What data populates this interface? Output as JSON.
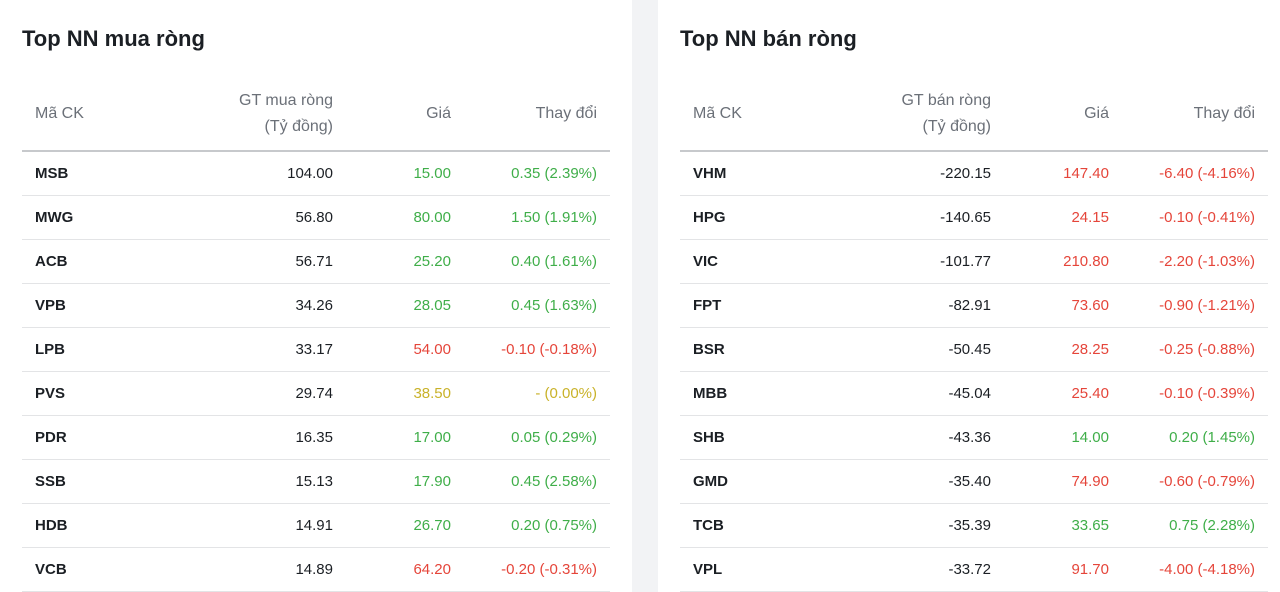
{
  "colors": {
    "up": "#3fae49",
    "down": "#e5453a",
    "reference": "#c9b229",
    "text": "#1b1f24",
    "header_text": "#6b7078"
  },
  "buy_panel": {
    "title": "Top NN mua ròng",
    "headers": {
      "symbol": "Mã CK",
      "value_line1": "GT mua ròng",
      "value_line2": "(Tỷ đồng)",
      "price": "Giá",
      "change": "Thay đổi"
    },
    "rows": [
      {
        "symbol": "MSB",
        "value": "104.00",
        "price": "15.00",
        "change": "0.35 (2.39%)",
        "trend": "up"
      },
      {
        "symbol": "MWG",
        "value": "56.80",
        "price": "80.00",
        "change": "1.50 (1.91%)",
        "trend": "up"
      },
      {
        "symbol": "ACB",
        "value": "56.71",
        "price": "25.20",
        "change": "0.40 (1.61%)",
        "trend": "up"
      },
      {
        "symbol": "VPB",
        "value": "34.26",
        "price": "28.05",
        "change": "0.45 (1.63%)",
        "trend": "up"
      },
      {
        "symbol": "LPB",
        "value": "33.17",
        "price": "54.00",
        "change": "-0.10 (-0.18%)",
        "trend": "down"
      },
      {
        "symbol": "PVS",
        "value": "29.74",
        "price": "38.50",
        "change": "- (0.00%)",
        "trend": "ref"
      },
      {
        "symbol": "PDR",
        "value": "16.35",
        "price": "17.00",
        "change": "0.05 (0.29%)",
        "trend": "up"
      },
      {
        "symbol": "SSB",
        "value": "15.13",
        "price": "17.90",
        "change": "0.45 (2.58%)",
        "trend": "up"
      },
      {
        "symbol": "HDB",
        "value": "14.91",
        "price": "26.70",
        "change": "0.20 (0.75%)",
        "trend": "up"
      },
      {
        "symbol": "VCB",
        "value": "14.89",
        "price": "64.20",
        "change": "-0.20 (-0.31%)",
        "trend": "down"
      }
    ]
  },
  "sell_panel": {
    "title": "Top NN bán ròng",
    "headers": {
      "symbol": "Mã CK",
      "value_line1": "GT bán ròng",
      "value_line2": "(Tỷ đồng)",
      "price": "Giá",
      "change": "Thay đổi"
    },
    "rows": [
      {
        "symbol": "VHM",
        "value": "-220.15",
        "price": "147.40",
        "change": "-6.40 (-4.16%)",
        "trend": "down"
      },
      {
        "symbol": "HPG",
        "value": "-140.65",
        "price": "24.15",
        "change": "-0.10 (-0.41%)",
        "trend": "down"
      },
      {
        "symbol": "VIC",
        "value": "-101.77",
        "price": "210.80",
        "change": "-2.20 (-1.03%)",
        "trend": "down"
      },
      {
        "symbol": "FPT",
        "value": "-82.91",
        "price": "73.60",
        "change": "-0.90 (-1.21%)",
        "trend": "down"
      },
      {
        "symbol": "BSR",
        "value": "-50.45",
        "price": "28.25",
        "change": "-0.25 (-0.88%)",
        "trend": "down"
      },
      {
        "symbol": "MBB",
        "value": "-45.04",
        "price": "25.40",
        "change": "-0.10 (-0.39%)",
        "trend": "down"
      },
      {
        "symbol": "SHB",
        "value": "-43.36",
        "price": "14.00",
        "change": "0.20 (1.45%)",
        "trend": "up"
      },
      {
        "symbol": "GMD",
        "value": "-35.40",
        "price": "74.90",
        "change": "-0.60 (-0.79%)",
        "trend": "down"
      },
      {
        "symbol": "TCB",
        "value": "-35.39",
        "price": "33.65",
        "change": "0.75 (2.28%)",
        "trend": "up"
      },
      {
        "symbol": "VPL",
        "value": "-33.72",
        "price": "91.70",
        "change": "-4.00 (-4.18%)",
        "trend": "down"
      }
    ]
  }
}
